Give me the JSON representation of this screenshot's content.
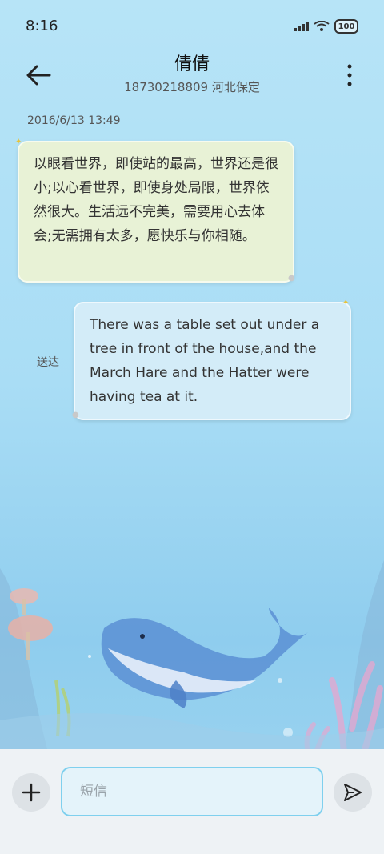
{
  "status_bar": {
    "time": "8:16",
    "battery": "100"
  },
  "header": {
    "contact_name": "倩倩",
    "subtitle": "18730218809 河北保定"
  },
  "conversation": {
    "date": "2016/6/13 13:49",
    "messages": [
      {
        "direction": "incoming",
        "text": "以眼看世界，即使站的最高，世界还是很小;以心看世界，即使身处局限，世界依然很大。生活远不完美，需要用心去体会;无需拥有太多，愿快乐与你相随。"
      },
      {
        "direction": "outgoing",
        "text": "There was a table set out under a tree in front of the house,and the March Hare and the Hatter were having tea at it.",
        "status": "送达"
      }
    ]
  },
  "composer": {
    "placeholder": "短信"
  },
  "colors": {
    "accent": "#7fd0ee",
    "incoming_bubble": "#e8f2d6",
    "outgoing_bubble": "#d3ecf8"
  }
}
